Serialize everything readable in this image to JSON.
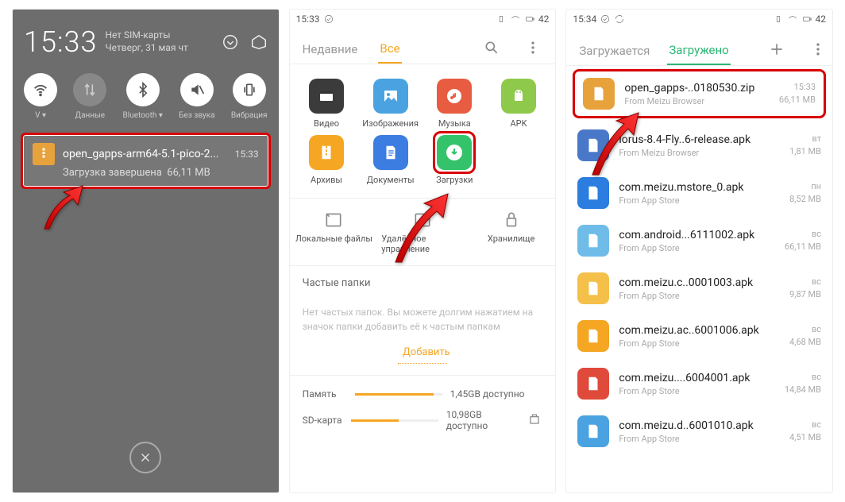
{
  "phone1": {
    "clock": "15:33",
    "sim": "Нет SIM-карты",
    "date": "Четверг, 31 мая чт",
    "toggles": [
      {
        "label": "V ▾"
      },
      {
        "label": "Данные"
      },
      {
        "label": "Bluetooth ▾"
      },
      {
        "label": "Без звука"
      },
      {
        "label": "Вибрация"
      }
    ],
    "notif": {
      "title": "open_gapps-arm64-5.1-pico-2...",
      "time": "15:33",
      "sub_status": "Загрузка завершена",
      "sub_size": "66,11 MB"
    }
  },
  "phone2": {
    "status_time": "15:33",
    "status_batt": "42",
    "tab_recent": "Недавние",
    "tab_all": "Все",
    "cats": [
      {
        "label": "Видео",
        "color": "#3b3b3b"
      },
      {
        "label": "Изображения",
        "color": "#4aa3e0"
      },
      {
        "label": "Музыка",
        "color": "#e85c41"
      },
      {
        "label": "APK",
        "color": "#8fc94b"
      },
      {
        "label": "Архивы",
        "color": "#f5a623"
      },
      {
        "label": "Документы",
        "color": "#3b7de0"
      },
      {
        "label": "Загрузки",
        "color": "#34c26b"
      }
    ],
    "sec2": [
      "Локальные файлы",
      "Удалённое управление",
      "Хранилище"
    ],
    "freq_title": "Частые папки",
    "freq_hint": "Нет частых папок. Вы можете долгим нажатием на значок папки добавить её к частым папкам",
    "add": "Добавить",
    "storage": [
      {
        "name": "Память",
        "avail": "1,45GB доступно",
        "pct": 90
      },
      {
        "name": "SD-карта",
        "avail": "10,98GB доступно",
        "pct": 55
      }
    ]
  },
  "phone3": {
    "status_time": "15:34",
    "status_batt": "42",
    "tab_loading": "Загружается",
    "tab_loaded": "Загружено",
    "files": [
      {
        "name": "open_gapps-..0180530.zip",
        "src": "From  Meizu Browser",
        "time": "15:33",
        "size": "66,11 MB",
        "color": "#e8a23c",
        "hi": true
      },
      {
        "name": "lorus-8.4-Fly..6-release.apk",
        "src": "From  Meizu Browser",
        "time": "вт",
        "size": "1,81 MB",
        "color": "#4a78c9"
      },
      {
        "name": "com.meizu.mstore_0.apk",
        "src": "From  App Store",
        "time": "пн",
        "size": "8,52 MB",
        "color": "#2b7de0"
      },
      {
        "name": "com.android...6111002.apk",
        "src": "From  App Store",
        "time": "вс",
        "size": "66,11 MB",
        "color": "#6fbce8"
      },
      {
        "name": "com.meizu.c..0001003.apk",
        "src": "From  App Store",
        "time": "вс",
        "size": "9,87 MB",
        "color": "#f5c04a"
      },
      {
        "name": "com.meizu.ac..6001006.apk",
        "src": "From  App Store",
        "time": "вс",
        "size": "4,68 MB",
        "color": "#f5a623"
      },
      {
        "name": "com.meizu....6004001.apk",
        "src": "From  App Store",
        "time": "вс",
        "size": "14,84 MB",
        "color": "#e04a3b"
      },
      {
        "name": "com.meizu.d..6001010.apk",
        "src": "From  App Store",
        "time": "вс",
        "size": "4,51 MB",
        "color": "#4aa3e0"
      }
    ]
  }
}
